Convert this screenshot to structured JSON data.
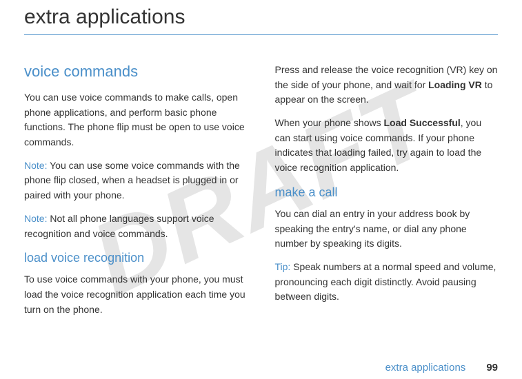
{
  "watermark": "DRAFT",
  "pageTitle": "extra applications",
  "left": {
    "sectionTitle": "voice commands",
    "p1": "You can use voice commands to make calls, open phone applications, and perform basic phone functions. The phone flip must be open to use voice commands.",
    "noteLabel1": "Note:",
    "note1": " You can use some voice commands with the phone flip closed, when a headset is plugged in or paired with your phone.",
    "noteLabel2": "Note:",
    "note2": " Not all phone languages support voice recognition and voice commands.",
    "subTitle": "load voice recognition",
    "p2": "To use voice commands with your phone, you must load the voice recognition application each time you turn on the phone."
  },
  "right": {
    "p1a": "Press and release the voice recognition (VR) key on the side of your phone, and wait for ",
    "bold1": "Loading VR",
    "p1b": " to appear on the screen.",
    "p2a": "When your phone shows ",
    "bold2": "Load Successful",
    "p2b": ", you can start using voice commands. If your phone indicates that loading failed, try again to load the voice recognition application.",
    "subTitle": "make a call",
    "p3": "You can dial an entry in your address book by speaking the entry's name, or dial any phone number by speaking its digits.",
    "tipLabel": "Tip:",
    "tip": " Speak numbers at a normal speed and volume, pronouncing each digit distinctly. Avoid pausing between digits."
  },
  "footer": {
    "title": "extra applications",
    "pageNumber": "99"
  }
}
